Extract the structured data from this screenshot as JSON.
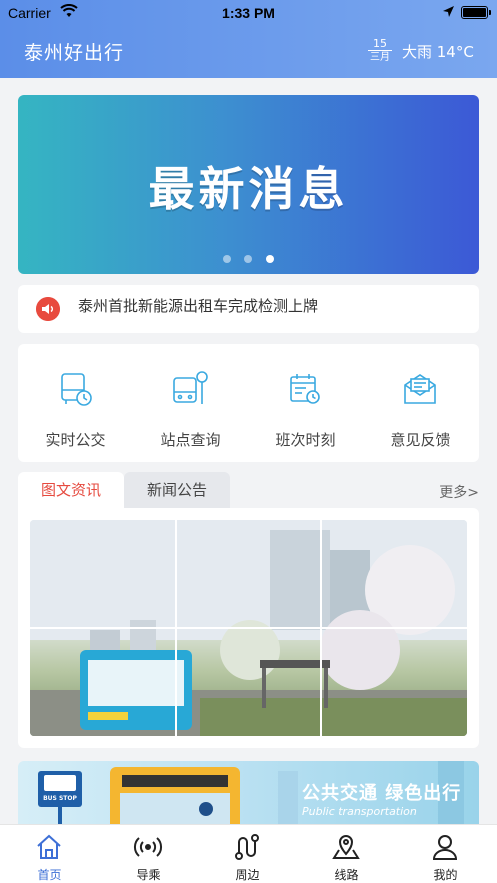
{
  "status_bar": {
    "carrier": "Carrier",
    "time": "1:33 PM"
  },
  "header": {
    "title": "泰州好出行",
    "date_day": "15",
    "date_month": "三月",
    "weather": "大雨 14°C"
  },
  "banner": {
    "headline": "最新消息",
    "slide_count": 3,
    "active_slide": 3
  },
  "notice": {
    "icon": "speaker-icon",
    "text": "泰州首批新能源出租车完成检测上牌"
  },
  "services": [
    {
      "label": "实时公交",
      "icon": "bus-clock-icon"
    },
    {
      "label": "站点查询",
      "icon": "bus-stop-icon"
    },
    {
      "label": "班次时刻",
      "icon": "calendar-clock-icon"
    },
    {
      "label": "意见反馈",
      "icon": "envelope-icon"
    }
  ],
  "news_tabs": {
    "tabs": [
      "图文资讯",
      "新闻公告"
    ],
    "active_tab": "图文资讯",
    "more": "更多>"
  },
  "promo": {
    "title": "公共交通 绿色出行",
    "subtitle": "Public transportation",
    "sign": "BUS STOP"
  },
  "tabbar": {
    "items": [
      {
        "label": "首页",
        "icon": "home-icon",
        "active": true
      },
      {
        "label": "导乘",
        "icon": "signal-icon",
        "active": false
      },
      {
        "label": "周边",
        "icon": "route-icon",
        "active": false
      },
      {
        "label": "线路",
        "icon": "map-pin-icon",
        "active": false
      },
      {
        "label": "我的",
        "icon": "user-icon",
        "active": false
      }
    ]
  },
  "colors": {
    "accent": "#3d6fd6",
    "active_tab": "#e64a3f",
    "icon_blue": "#3aa9e0"
  }
}
